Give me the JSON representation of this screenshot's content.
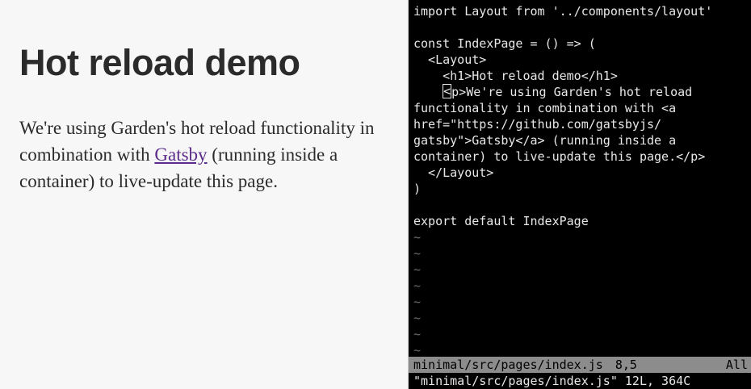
{
  "browser": {
    "title": "Hot reload demo",
    "para_before": "We're using Garden's hot reload functionality in combination with ",
    "link_text": "Gatsby",
    "para_after": " (running inside a container) to live-update this page."
  },
  "editor": {
    "lines": [
      "import Layout from '../components/layout'",
      "",
      "const IndexPage = () => (",
      "  <Layout>",
      "    <h1>Hot reload demo</h1>",
      "    <p>We're using Garden's hot reload",
      "functionality in combination with <a",
      "href=\"https://github.com/gatsbyjs/",
      "gatsby\">Gatsby</a> (running inside a",
      "container) to live-update this page.</p>",
      "  </Layout>",
      ")",
      "",
      "export default IndexPage"
    ],
    "cursor_line": {
      "before": "    ",
      "cursor_char": "<",
      "after": "p>We're using Garden's hot reload"
    },
    "empty_line_marker": "~",
    "status": {
      "filename": "minimal/src/pages/index.js",
      "position": "8,5",
      "scroll": "All"
    },
    "message": "\"minimal/src/pages/index.js\" 12L, 364C"
  }
}
